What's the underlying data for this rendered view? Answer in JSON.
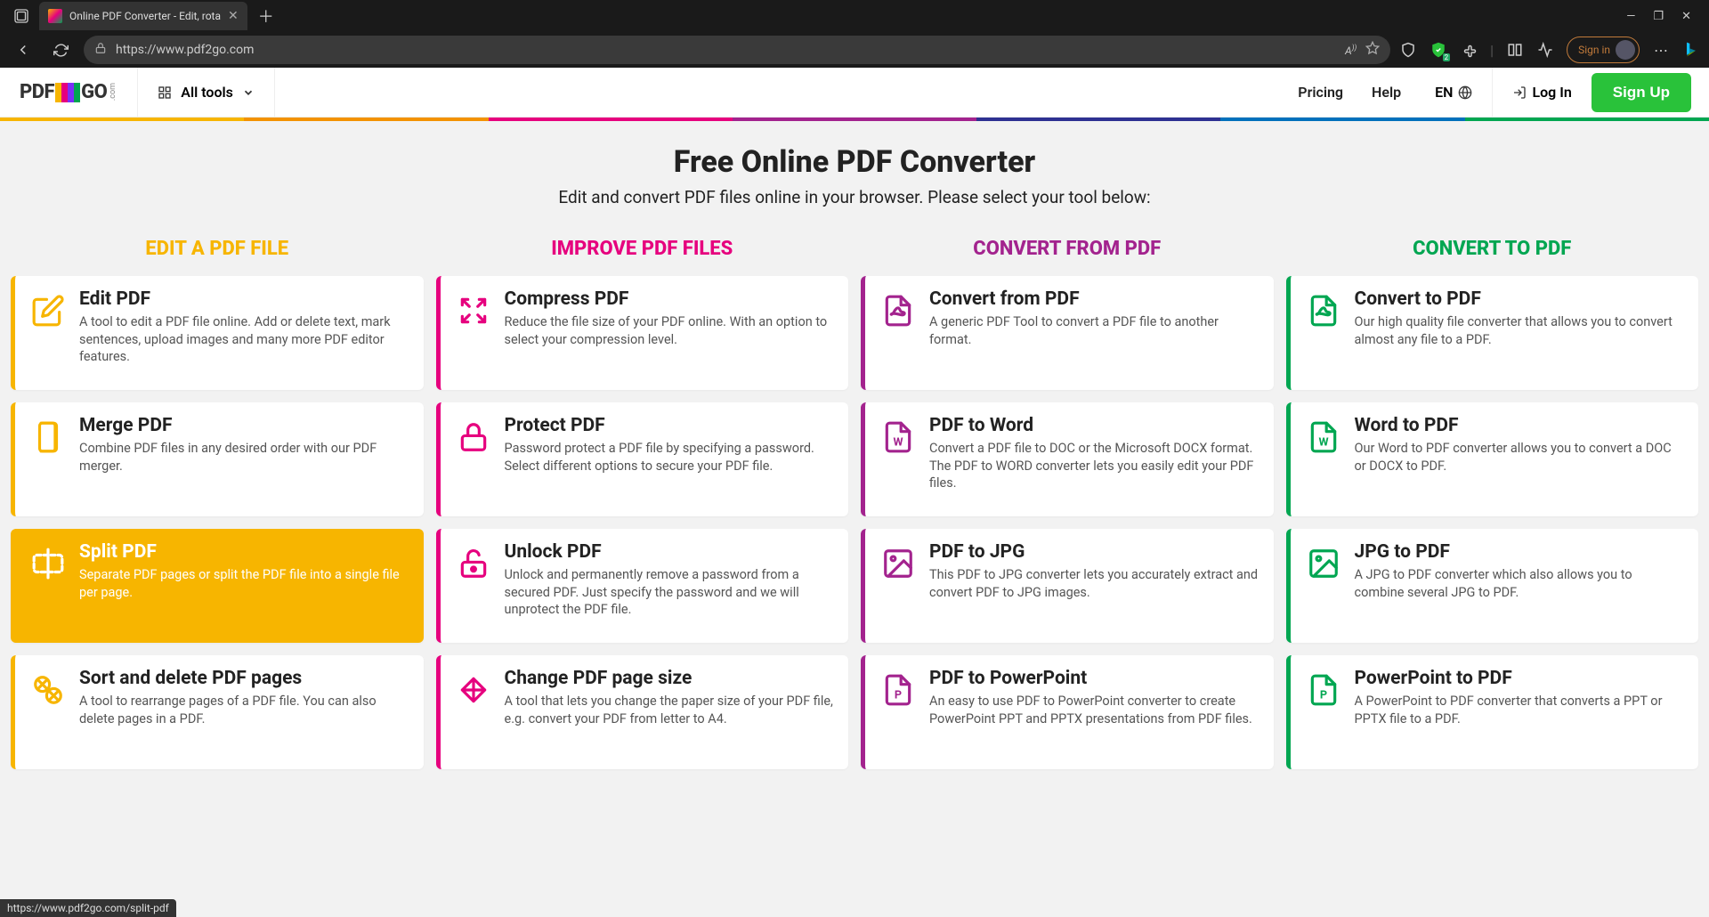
{
  "browser": {
    "tab_title": "Online PDF Converter - Edit, rota",
    "url": "https://www.pdf2go.com",
    "signin": "Sign in",
    "shield_count": "2"
  },
  "nav": {
    "logo_prefix": "PDF",
    "logo_suffix": "GO",
    "logo_dotcom": ".com",
    "alltools": "All tools",
    "pricing": "Pricing",
    "help": "Help",
    "lang": "EN",
    "login": "Log In",
    "signup": "Sign Up"
  },
  "hero": {
    "title": "Free Online PDF Converter",
    "subtitle": "Edit and convert PDF files online in your browser. Please select your tool below:"
  },
  "columns": [
    {
      "header": "EDIT A PDF FILE",
      "color": "yellow"
    },
    {
      "header": "IMPROVE PDF FILES",
      "color": "pink"
    },
    {
      "header": "CONVERT FROM PDF",
      "color": "purple"
    },
    {
      "header": "CONVERT TO PDF",
      "color": "green"
    }
  ],
  "cards": {
    "col0": [
      {
        "title": "Edit PDF",
        "desc": "A tool to edit a PDF file online. Add or delete text, mark sentences, upload images and many more PDF editor features.",
        "icon": "edit"
      },
      {
        "title": "Merge PDF",
        "desc": "Combine PDF files in any desired order with our PDF merger.",
        "icon": "merge"
      },
      {
        "title": "Split PDF",
        "desc": "Separate PDF pages or split the PDF file into a single file per page.",
        "icon": "split",
        "active": true
      },
      {
        "title": "Sort and delete PDF pages",
        "desc": "A tool to rearrange pages of a PDF file. You can also delete pages in a PDF.",
        "icon": "sort"
      }
    ],
    "col1": [
      {
        "title": "Compress PDF",
        "desc": "Reduce the file size of your PDF online. With an option to select your compression level.",
        "icon": "compress"
      },
      {
        "title": "Protect PDF",
        "desc": "Password protect a PDF file by specifying a password. Select different options to secure your PDF file.",
        "icon": "lock"
      },
      {
        "title": "Unlock PDF",
        "desc": "Unlock and permanently remove a password from a secured PDF. Just specify the password and we will unprotect the PDF file.",
        "icon": "unlock"
      },
      {
        "title": "Change PDF page size",
        "desc": "A tool that lets you change the paper size of your PDF file, e.g. convert your PDF from letter to A4.",
        "icon": "resize"
      }
    ],
    "col2": [
      {
        "title": "Convert from PDF",
        "desc": "A generic PDF Tool to convert a PDF file to another format.",
        "icon": "pdf"
      },
      {
        "title": "PDF to Word",
        "desc": "Convert a PDF file to DOC or the Microsoft DOCX format. The PDF to WORD converter lets you easily edit your PDF files.",
        "icon": "word"
      },
      {
        "title": "PDF to JPG",
        "desc": "This PDF to JPG converter lets you accurately extract and convert PDF to JPG images.",
        "icon": "image"
      },
      {
        "title": "PDF to PowerPoint",
        "desc": "An easy to use PDF to PowerPoint converter to create PowerPoint PPT and PPTX presentations from PDF files.",
        "icon": "ppt"
      }
    ],
    "col3": [
      {
        "title": "Convert to PDF",
        "desc": "Our high quality file converter that allows you to convert almost any file to a PDF.",
        "icon": "pdf"
      },
      {
        "title": "Word to PDF",
        "desc": "Our Word to PDF converter allows you to convert a DOC or DOCX to PDF.",
        "icon": "word"
      },
      {
        "title": "JPG to PDF",
        "desc": "A JPG to PDF converter which also allows you to combine several JPG to PDF.",
        "icon": "image"
      },
      {
        "title": "PowerPoint to PDF",
        "desc": "A PowerPoint to PDF converter that converts a PPT or PPTX file to a PDF.",
        "icon": "ppt"
      }
    ]
  },
  "status": "https://www.pdf2go.com/split-pdf",
  "icon_colors": {
    "yellow": "#f7b500",
    "pink": "#e6007e",
    "purple": "#a3238e",
    "green": "#00a651",
    "white": "#ffffff"
  }
}
